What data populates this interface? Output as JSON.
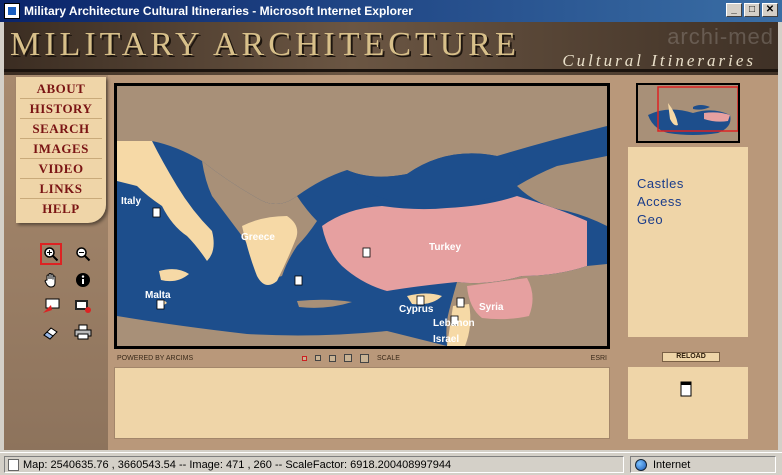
{
  "window": {
    "title": "Military Architecture Cultural Itineraries - Microsoft Internet Explorer",
    "min_label": "_",
    "max_label": "□",
    "close_label": "✕"
  },
  "banner": {
    "title": "MILITARY ARCHITECTURE",
    "subtitle": "Cultural Itineraries",
    "watermark": "archi-med"
  },
  "nav": {
    "items": [
      {
        "label": "ABOUT"
      },
      {
        "label": "HISTORY"
      },
      {
        "label": "SEARCH"
      },
      {
        "label": "IMAGES"
      },
      {
        "label": "VIDEO"
      },
      {
        "label": "LINKS"
      },
      {
        "label": "HELP"
      }
    ]
  },
  "tools": [
    {
      "icon": "zoom-in-icon",
      "active": true
    },
    {
      "icon": "zoom-out-icon",
      "active": false
    },
    {
      "icon": "pan-hand-icon",
      "active": false
    },
    {
      "icon": "identify-info-icon",
      "active": false
    },
    {
      "icon": "select-box-icon",
      "active": false
    },
    {
      "icon": "measure-film-icon",
      "active": false
    },
    {
      "icon": "eraser-clear-icon",
      "active": false
    },
    {
      "icon": "print-icon",
      "active": false
    }
  ],
  "map": {
    "labels": {
      "italy": "Italy",
      "greece": "Greece",
      "turkey": "Turkey",
      "malta": "Malta",
      "cyprus": "Cyprus",
      "syria": "Syria",
      "lebanon": "Lebanon",
      "israel": "Israel"
    },
    "colors": {
      "sea": "#1d4e8c",
      "land": "#a89078",
      "highlight_light": "#f6d9a6",
      "highlight_turkey": "#e6a0a0"
    }
  },
  "map_footer": {
    "powered": "POWERED BY ARCIMS",
    "scale": "SCALE",
    "esri": "ESRI"
  },
  "layers": {
    "items": [
      "Castles",
      "Access",
      "Geo"
    ]
  },
  "reload_label": "RELOAD",
  "status": {
    "text": "Map: 2540635.76 , 3660543.54 -- Image: 471 , 260 -- ScaleFactor: 6918.200408997944",
    "zone": "Internet"
  }
}
